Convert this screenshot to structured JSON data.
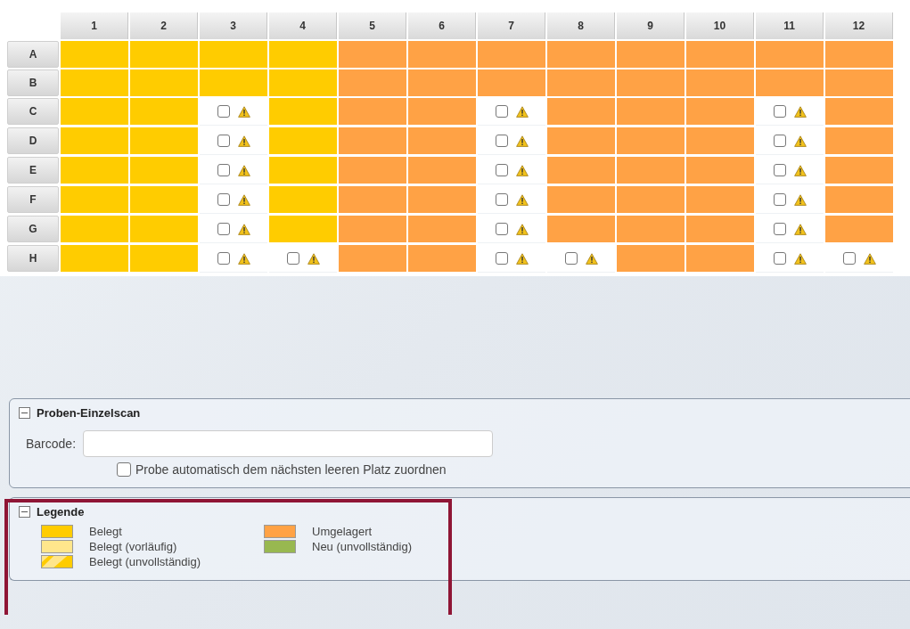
{
  "plate": {
    "columns": [
      "1",
      "2",
      "3",
      "4",
      "5",
      "6",
      "7",
      "8",
      "9",
      "10",
      "11",
      "12"
    ],
    "rows": [
      {
        "label": "A",
        "cells": [
          {
            "kind": "occupied"
          },
          {
            "kind": "occupied"
          },
          {
            "kind": "occupied"
          },
          {
            "kind": "occupied"
          },
          {
            "kind": "relocated"
          },
          {
            "kind": "relocated"
          },
          {
            "kind": "relocated"
          },
          {
            "kind": "relocated"
          },
          {
            "kind": "relocated"
          },
          {
            "kind": "relocated"
          },
          {
            "kind": "relocated"
          },
          {
            "kind": "relocated"
          }
        ]
      },
      {
        "label": "B",
        "cells": [
          {
            "kind": "occupied"
          },
          {
            "kind": "occupied"
          },
          {
            "kind": "occupied"
          },
          {
            "kind": "occupied"
          },
          {
            "kind": "relocated"
          },
          {
            "kind": "relocated"
          },
          {
            "kind": "relocated"
          },
          {
            "kind": "relocated"
          },
          {
            "kind": "relocated"
          },
          {
            "kind": "relocated"
          },
          {
            "kind": "relocated"
          },
          {
            "kind": "relocated"
          }
        ]
      },
      {
        "label": "C",
        "cells": [
          {
            "kind": "occupied"
          },
          {
            "kind": "occupied"
          },
          {
            "kind": "empty",
            "checked": false
          },
          {
            "kind": "occupied"
          },
          {
            "kind": "relocated"
          },
          {
            "kind": "relocated"
          },
          {
            "kind": "empty",
            "checked": false
          },
          {
            "kind": "relocated"
          },
          {
            "kind": "relocated"
          },
          {
            "kind": "relocated"
          },
          {
            "kind": "empty",
            "checked": false
          },
          {
            "kind": "relocated"
          }
        ]
      },
      {
        "label": "D",
        "cells": [
          {
            "kind": "occupied"
          },
          {
            "kind": "occupied"
          },
          {
            "kind": "empty",
            "checked": false
          },
          {
            "kind": "occupied"
          },
          {
            "kind": "relocated"
          },
          {
            "kind": "relocated"
          },
          {
            "kind": "empty",
            "checked": false
          },
          {
            "kind": "relocated"
          },
          {
            "kind": "relocated"
          },
          {
            "kind": "relocated"
          },
          {
            "kind": "empty",
            "checked": false
          },
          {
            "kind": "relocated"
          }
        ]
      },
      {
        "label": "E",
        "cells": [
          {
            "kind": "occupied"
          },
          {
            "kind": "occupied"
          },
          {
            "kind": "empty",
            "checked": false
          },
          {
            "kind": "occupied"
          },
          {
            "kind": "relocated"
          },
          {
            "kind": "relocated"
          },
          {
            "kind": "empty",
            "checked": false
          },
          {
            "kind": "relocated"
          },
          {
            "kind": "relocated"
          },
          {
            "kind": "relocated"
          },
          {
            "kind": "empty",
            "checked": false
          },
          {
            "kind": "relocated"
          }
        ]
      },
      {
        "label": "F",
        "cells": [
          {
            "kind": "occupied"
          },
          {
            "kind": "occupied"
          },
          {
            "kind": "empty",
            "checked": false
          },
          {
            "kind": "occupied"
          },
          {
            "kind": "relocated"
          },
          {
            "kind": "relocated"
          },
          {
            "kind": "empty",
            "checked": false
          },
          {
            "kind": "relocated"
          },
          {
            "kind": "relocated"
          },
          {
            "kind": "relocated"
          },
          {
            "kind": "empty",
            "checked": false
          },
          {
            "kind": "relocated"
          }
        ]
      },
      {
        "label": "G",
        "cells": [
          {
            "kind": "occupied"
          },
          {
            "kind": "occupied"
          },
          {
            "kind": "empty",
            "checked": false
          },
          {
            "kind": "occupied"
          },
          {
            "kind": "relocated"
          },
          {
            "kind": "relocated"
          },
          {
            "kind": "empty",
            "checked": false
          },
          {
            "kind": "relocated"
          },
          {
            "kind": "relocated"
          },
          {
            "kind": "relocated"
          },
          {
            "kind": "empty",
            "checked": false
          },
          {
            "kind": "relocated"
          }
        ]
      },
      {
        "label": "H",
        "cells": [
          {
            "kind": "occupied"
          },
          {
            "kind": "occupied"
          },
          {
            "kind": "empty",
            "checked": false
          },
          {
            "kind": "empty",
            "checked": false
          },
          {
            "kind": "relocated"
          },
          {
            "kind": "relocated"
          },
          {
            "kind": "empty",
            "checked": false
          },
          {
            "kind": "empty",
            "checked": false
          },
          {
            "kind": "relocated"
          },
          {
            "kind": "relocated"
          },
          {
            "kind": "empty",
            "checked": false
          },
          {
            "kind": "empty",
            "checked": false
          }
        ]
      }
    ]
  },
  "single_scan": {
    "title": "Proben-Einzelscan",
    "expanded": true,
    "barcode_label": "Barcode:",
    "auto_assign": {
      "label": "Probe automatisch dem nächsten leeren Platz zuordnen",
      "checked": false
    }
  },
  "legend": {
    "title": "Legende",
    "expanded": true,
    "items": [
      {
        "label": "Belegt",
        "kind": "solid",
        "color": "#ffcc00"
      },
      {
        "label": "Belegt (vorläufig)",
        "kind": "solid",
        "color": "#ffe68c"
      },
      {
        "label": "Belegt (unvollständig)",
        "kind": "striped",
        "color": "#ffcc00"
      },
      {
        "label": "Umgelagert",
        "kind": "solid",
        "color": "#ffa245"
      },
      {
        "label": "Neu (unvollständig)",
        "kind": "solid",
        "color": "#98b850"
      }
    ]
  }
}
